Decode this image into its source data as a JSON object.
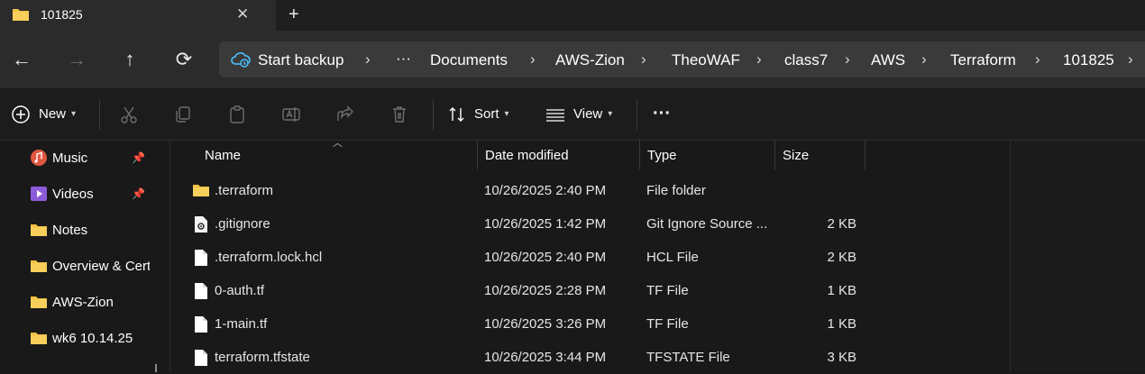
{
  "tab": {
    "title": "101825",
    "close": "✕",
    "new_tab": "+"
  },
  "nav": {
    "back": "←",
    "forward": "→",
    "up": "↑",
    "refresh": "⟳"
  },
  "address": {
    "backup_label": "Start backup",
    "overflow": "···",
    "separator": "›",
    "crumbs": [
      "Documents",
      "AWS-Zion",
      "TheoWAF",
      "class7",
      "AWS",
      "Terraform",
      "101825"
    ]
  },
  "toolbar": {
    "new_label": "New",
    "sort_label": "Sort",
    "view_label": "View",
    "more": "···"
  },
  "sidebar": {
    "items": [
      {
        "label": "Music",
        "icon": "music-icon",
        "pinned": true
      },
      {
        "label": "Videos",
        "icon": "videos-icon",
        "pinned": true
      },
      {
        "label": "Notes",
        "icon": "folder-icon",
        "pinned": false
      },
      {
        "label": "Overview & Cert",
        "icon": "folder-icon",
        "pinned": false
      },
      {
        "label": "AWS-Zion",
        "icon": "folder-icon",
        "pinned": false
      },
      {
        "label": "wk6 10.14.25",
        "icon": "folder-icon",
        "pinned": false
      }
    ]
  },
  "table": {
    "columns": [
      "Name",
      "Date modified",
      "Type",
      "Size"
    ],
    "rows": [
      {
        "name": ".terraform",
        "date": "10/26/2025 2:40 PM",
        "type": "File folder",
        "size": "",
        "icon": "folder-icon"
      },
      {
        "name": ".gitignore",
        "date": "10/26/2025 1:42 PM",
        "type": "Git Ignore Source ...",
        "size": "2 KB",
        "icon": "gear-file-icon"
      },
      {
        "name": ".terraform.lock.hcl",
        "date": "10/26/2025 2:40 PM",
        "type": "HCL File",
        "size": "2 KB",
        "icon": "file-icon"
      },
      {
        "name": "0-auth.tf",
        "date": "10/26/2025 2:28 PM",
        "type": "TF File",
        "size": "1 KB",
        "icon": "file-icon"
      },
      {
        "name": "1-main.tf",
        "date": "10/26/2025 3:26 PM",
        "type": "TF File",
        "size": "1 KB",
        "icon": "file-icon"
      },
      {
        "name": "terraform.tfstate",
        "date": "10/26/2025 3:44 PM",
        "type": "TFSTATE File",
        "size": "3 KB",
        "icon": "file-icon"
      }
    ]
  },
  "colors": {
    "folder": "#f3c244",
    "accent": "#4cc2ff"
  }
}
